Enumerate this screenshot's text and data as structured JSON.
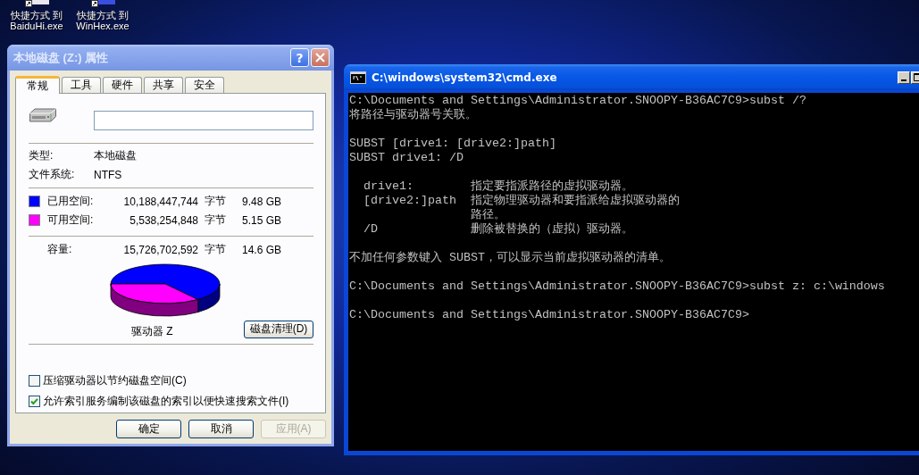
{
  "desktop": {
    "icons": [
      {
        "label": "快捷方式 到\nBaiduHi.exe"
      },
      {
        "label": "快捷方式 到\nWinHex.exe"
      }
    ]
  },
  "properties_dialog": {
    "title": "本地磁盘 (Z:) 属性",
    "help_button": "?",
    "tabs": [
      {
        "label": "常规",
        "selected": true
      },
      {
        "label": "工具",
        "selected": false
      },
      {
        "label": "硬件",
        "selected": false
      },
      {
        "label": "共享",
        "selected": false
      },
      {
        "label": "安全",
        "selected": false
      }
    ],
    "info": [
      {
        "label": "类型:",
        "value": "本地磁盘"
      },
      {
        "label": "文件系统:",
        "value": "NTFS"
      }
    ],
    "space": [
      {
        "label": "已用空间:",
        "bytes": "10,188,447,744",
        "unit": "字节",
        "size": "9.48 GB",
        "color": "#0000ff"
      },
      {
        "label": "可用空间:",
        "bytes": "5,538,254,848",
        "unit": "字节",
        "size": "5.15 GB",
        "color": "#ff00ff"
      }
    ],
    "capacity": {
      "label": "容量:",
      "bytes": "15,726,702,592",
      "unit": "字节",
      "size": "14.6 GB"
    },
    "drive_label": "驱动器 Z",
    "cleanup_button": "磁盘清理(D)",
    "checkboxes": [
      {
        "label": "压缩驱动器以节约磁盘空间(C)",
        "checked": false
      },
      {
        "label": "允许索引服务编制该磁盘的索引以便快速搜索文件(I)",
        "checked": true
      }
    ],
    "buttons": [
      {
        "label": "确定",
        "disabled": false
      },
      {
        "label": "取消",
        "disabled": false
      },
      {
        "label": "应用(A)",
        "disabled": true
      }
    ]
  },
  "console_window": {
    "title": "C:\\windows\\system32\\cmd.exe",
    "paragraphs": [
      [
        {
          "kind": "text",
          "text": "C:\\Documents and Settings\\Administrator.SNOOPY-B36AC7C9>subst /?"
        },
        {
          "kind": "text",
          "text": "将路径与驱动器号关联。"
        }
      ],
      [
        {
          "kind": "text",
          "text": "SUBST [drive1: [drive2:]path]"
        },
        {
          "kind": "text",
          "text": "SUBST drive1: /D"
        }
      ],
      [
        {
          "kind": "option",
          "option": "drive1:",
          "description": "指定要指派路径的虚拟驱动器。"
        },
        {
          "kind": "option",
          "option": "[drive2:]path",
          "description": "指定物理驱动器和要指派给虚拟驱动器的"
        },
        {
          "kind": "option",
          "description": "路径。"
        },
        {
          "kind": "option",
          "option": "/D",
          "description": "删除被替换的（虚拟）驱动器。"
        }
      ],
      [
        {
          "kind": "text",
          "text": "不加任何参数键入 SUBST，可以显示当前虚拟驱动器的清单。"
        }
      ],
      [
        {
          "kind": "text",
          "text": "C:\\Documents and Settings\\Administrator.SNOOPY-B36AC7C9>subst z: c:\\windows"
        }
      ],
      [
        {
          "kind": "text",
          "text": "C:\\Documents and Settings\\Administrator.SNOOPY-B36AC7C9>"
        }
      ]
    ]
  }
}
